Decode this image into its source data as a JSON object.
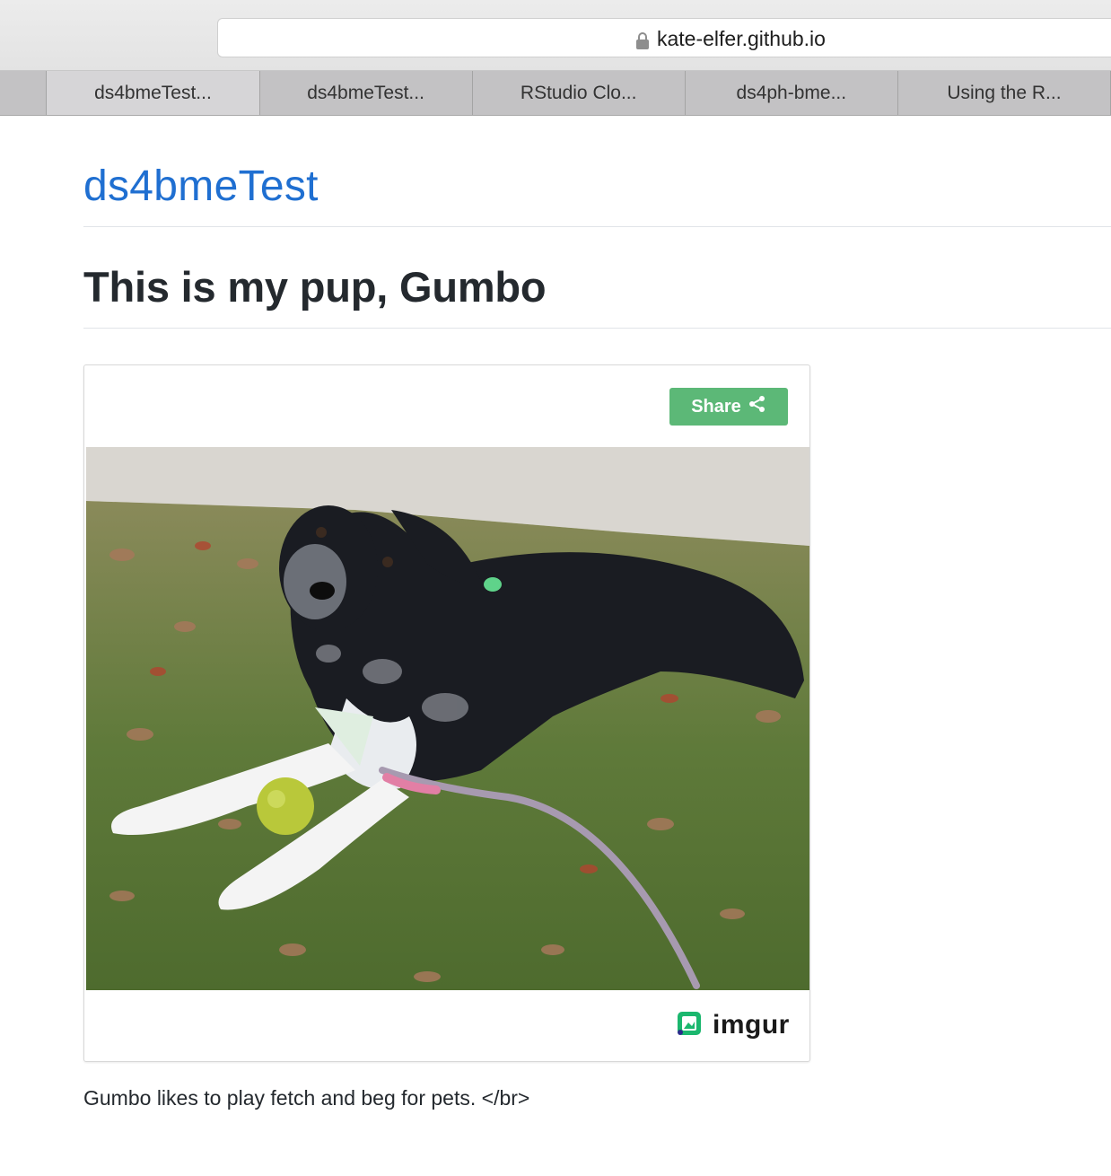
{
  "browser": {
    "url": "kate-elfer.github.io",
    "tabs": [
      {
        "label": "ds4bmeTest...",
        "active": true
      },
      {
        "label": "ds4bmeTest...",
        "active": false
      },
      {
        "label": "RStudio Clo...",
        "active": false
      },
      {
        "label": "ds4ph-bme...",
        "active": false
      },
      {
        "label": "Using the R...",
        "active": false
      }
    ]
  },
  "site": {
    "title": "ds4bmeTest"
  },
  "page": {
    "heading": "This is my pup, Gumbo",
    "caption": "Gumbo likes to play fetch and beg for pets. </br>"
  },
  "embed": {
    "share_label": "Share",
    "share_icon": "share-icon",
    "brand": "imgur",
    "brand_icon": "imgur-logo-icon",
    "accent_color": "#5cb877"
  },
  "colors": {
    "link": "#1f6fd1",
    "text": "#24292e"
  }
}
